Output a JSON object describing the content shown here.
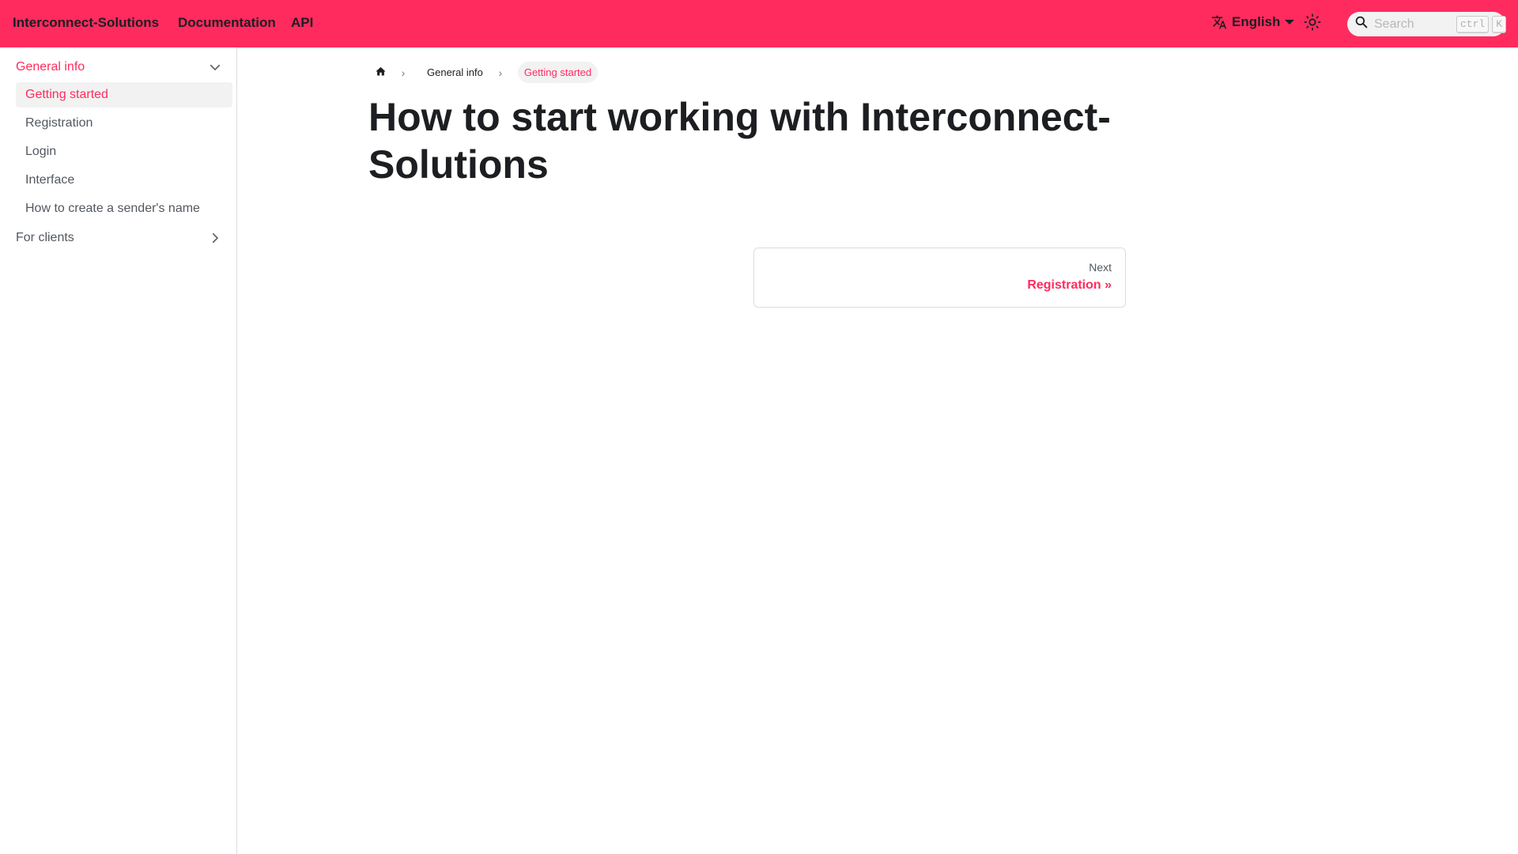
{
  "navbar": {
    "brand": "Interconnect-Solutions",
    "links": [
      "Documentation",
      "API"
    ],
    "language": "English",
    "search_placeholder": "Search",
    "shortcut_keys": [
      "ctrl",
      "K"
    ],
    "accent_color": "#ff2b5e"
  },
  "sidebar": {
    "categories": [
      {
        "label": "General info",
        "expanded": true,
        "items": [
          {
            "label": "Getting started",
            "active": true
          },
          {
            "label": "Registration"
          },
          {
            "label": "Login"
          },
          {
            "label": "Interface"
          },
          {
            "label": "How to create a sender's name"
          }
        ]
      },
      {
        "label": "For clients",
        "expanded": false
      }
    ]
  },
  "breadcrumbs": {
    "items": [
      "General info",
      "Getting started"
    ]
  },
  "page": {
    "title": "How to start working with Interconnect-Solutions"
  },
  "pagination": {
    "next_sublabel": "Next",
    "next_label": "Registration »"
  },
  "icons": {
    "translate": "translate-icon",
    "language_dropdown": "caret-down-icon",
    "theme": "sun-icon",
    "search": "search-icon",
    "home": "home-icon",
    "category_expanded": "chevron-down-icon",
    "category_collapsed": "chevron-right-icon",
    "breadcrumb_separator": "chevron-right-icon"
  }
}
